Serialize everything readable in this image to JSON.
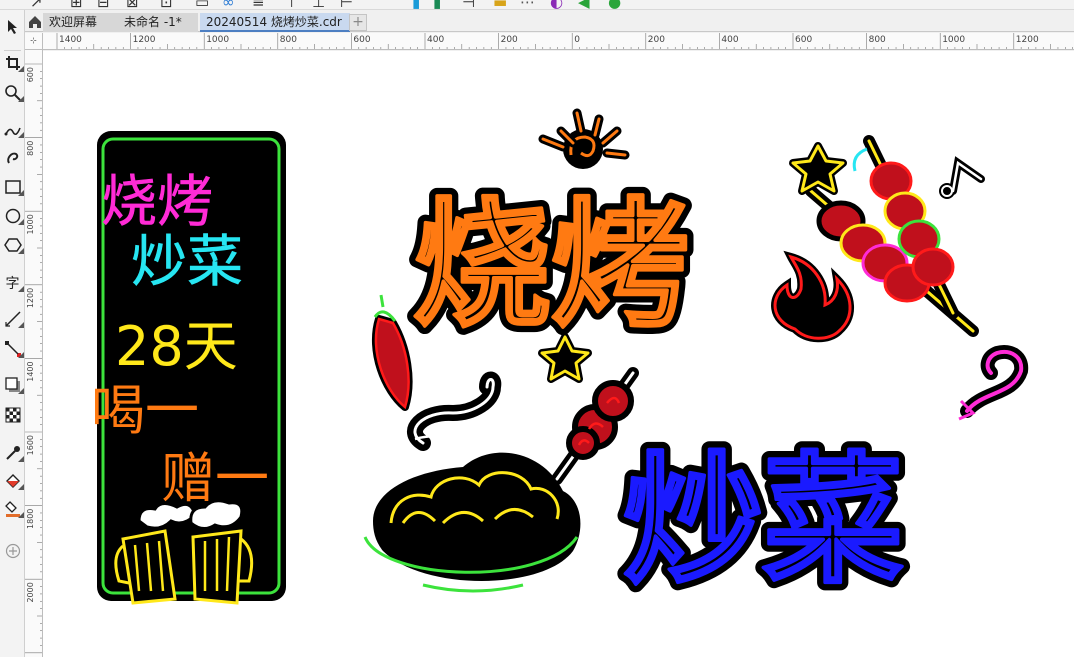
{
  "tabs": {
    "welcome": "欢迎屏幕",
    "untitled": "未命名 -1*",
    "active": "20240514 烧烤炒菜.cdr"
  },
  "ruler_h_labels": [
    "1400",
    "1200",
    "1000",
    "800",
    "600",
    "400",
    "200",
    "0",
    "200",
    "400",
    "600",
    "800",
    "1000",
    "1200"
  ],
  "ruler_v_labels": [
    "600",
    "800",
    "1000",
    "1200",
    "1400",
    "1600",
    "1800",
    "2000"
  ],
  "toolbox": {
    "text_tool": "字"
  },
  "artwork": {
    "sign": {
      "line1": "烧烤",
      "line2": "炒菜",
      "line3": "28天",
      "line4": "喝一",
      "line5": "赠一"
    },
    "big_title_1": "烧烤",
    "big_title_2": "炒菜"
  },
  "colors": {
    "accent_tab": "#4d7fc2",
    "neon_magenta": "#ff2bd6",
    "neon_cyan": "#27e6f2",
    "neon_yellow": "#ffe81a",
    "neon_orange": "#ff7a12",
    "neon_green": "#3ce33c",
    "neon_red": "#ff1a1a",
    "neon_blue": "#1a1aff"
  }
}
